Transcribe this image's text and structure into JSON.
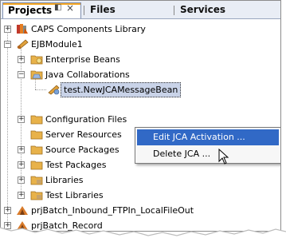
{
  "tabs": [
    {
      "label": "Projects",
      "active": true
    },
    {
      "label": "Files",
      "active": false
    },
    {
      "label": "Services",
      "active": false
    }
  ],
  "tab_controls": {
    "restore": "◧",
    "close": "×"
  },
  "tree": {
    "caps": "CAPS Components Library",
    "ejbmodule": "EJBModule1",
    "enterprise_beans": "Enterprise Beans",
    "java_collaborations": "Java Collaborations",
    "message_bean": "test.NewJCAMessageBean",
    "configuration_files": "Configuration Files",
    "server_resources": "Server Resources",
    "source_packages": "Source Packages",
    "test_packages": "Test Packages",
    "libraries": "Libraries",
    "test_libraries": "Test Libraries",
    "prj_inbound": "prjBatch_Inbound_FTPIn_LocalFileOut",
    "prj_record": "prjBatch_Record"
  },
  "context_menu": {
    "items": [
      {
        "label": "Edit JCA Activation ...",
        "highlighted": true
      },
      {
        "label": "Delete JCA ...",
        "highlighted": false
      }
    ]
  },
  "colors": {
    "selection": "#c9d3e8",
    "menu_highlight": "#3169c6",
    "folder": "#e8b24a",
    "tab_accent": "#f5a623"
  },
  "icons": {
    "caps": "library-icon",
    "ejbmodule": "ejb-module-icon",
    "folder": "folder-icon",
    "bean": "java-bean-icon",
    "prj": "project-icon"
  }
}
